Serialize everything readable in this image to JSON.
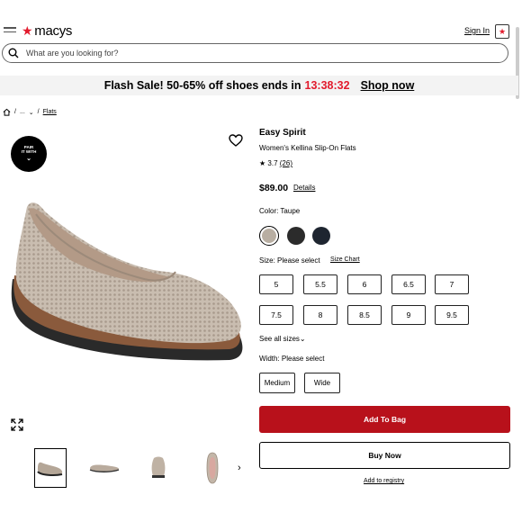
{
  "header": {
    "logo_text": "macys",
    "logo_star": "★",
    "sign_in": "Sign In",
    "bag_icon_glyph": "★",
    "brand_color": "#e21a2c"
  },
  "search": {
    "placeholder": "What are you looking for?"
  },
  "banner": {
    "text": "Flash Sale! 50-65% off shoes ends in",
    "timer": "13:38:32",
    "cta": "Shop now"
  },
  "breadcrumb": {
    "home_icon": "home-icon",
    "sep": "/",
    "ellipsis": "...",
    "chevron": "⌄",
    "current": "Flats"
  },
  "gallery": {
    "pair_with": [
      "PAIR",
      "IT WITH"
    ],
    "pair_chevron": "⌄",
    "next": "›"
  },
  "product": {
    "brand": "Easy Spirit",
    "name": "Women's Kellina Slip-On Flats",
    "rating_star": "★",
    "rating": "3.7",
    "review_count": "(26)",
    "price": "$89.00",
    "details": "Details",
    "color_label": "Color: Taupe",
    "swatches": [
      "#b8aea2",
      "#2b2b2b",
      "#1e2530"
    ],
    "size_label": "Size: Please select",
    "size_chart": "Size Chart",
    "sizes_row1": [
      "5",
      "5.5",
      "6",
      "6.5",
      "7"
    ],
    "sizes_row2": [
      "7.5",
      "8",
      "8.5",
      "9",
      "9.5"
    ],
    "see_all": "See all sizes",
    "see_all_chevron": "⌄",
    "width_label": "Width: Please select",
    "widths": [
      "Medium",
      "Wide"
    ],
    "add_to_bag": "Add To Bag",
    "add_to_bag_color": "#b8111b",
    "buy_now": "Buy Now",
    "registry": "Add to registry"
  }
}
